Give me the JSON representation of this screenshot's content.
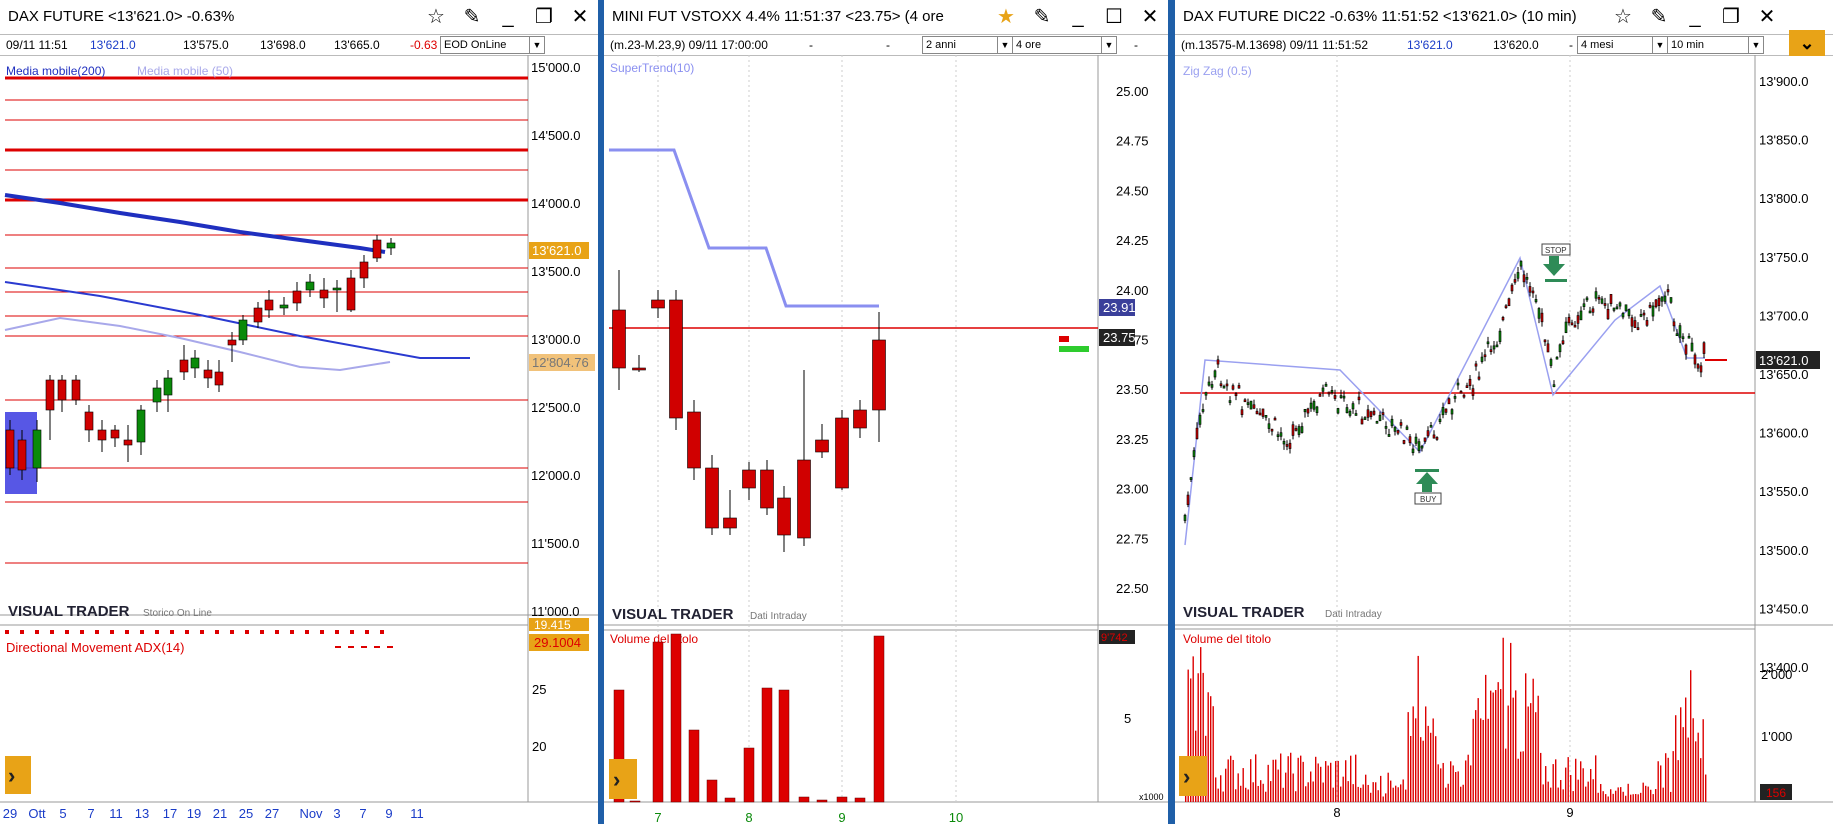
{
  "panels": {
    "left": {
      "title": "DAX FUTURE <13'621.0> -0.63%",
      "info": {
        "datetime": "09/11 11:51",
        "last": "13'621.0",
        "open": "13'575.0",
        "high": "13'698.0",
        "low": "13'665.0",
        "change": "-0.63"
      },
      "mode_dropdown": "EOD OnLine",
      "ma200_label": "Media mobile(200)",
      "ma50_label": "Media mobile (50)",
      "price_ticks": [
        "15'000.0",
        "14'500.0",
        "14'000.0",
        "13'500.0",
        "13'000.0",
        "12'500.0",
        "12'000.0",
        "11'500.0",
        "11'000.0"
      ],
      "price_badge": "13'621.0",
      "ma50_badge": "12'804.76",
      "logo": "VISUAL TRADER",
      "logo_sub": "Storico On Line",
      "adx_label": "Directional Movement ADX(14)",
      "adx_badge1": "19.415",
      "adx_badge2": "29.1004",
      "adx_ticks": [
        "25",
        "20"
      ],
      "date_ticks": [
        "29",
        "Ott",
        "5",
        "7",
        "11",
        "13",
        "17",
        "19",
        "21",
        "25",
        "27",
        "Nov",
        "3",
        "7",
        "9",
        "11"
      ]
    },
    "middle": {
      "title": "MINI FUT VSTOXX 4.4% 11:51:37  <23.75> (4 ore",
      "info": {
        "range": "(m.23-M.23,9) 09/11 17:00:00",
        "dash1": "-",
        "dash2": "-",
        "dash3": "-"
      },
      "period_dropdown": "2 anni",
      "interval_dropdown": "4 ore",
      "indicator_label": "SuperTrend(10)",
      "price_ticks": [
        "25.00",
        "24.75",
        "24.50",
        "24.25",
        "24.00",
        "23.75",
        "23.50",
        "23.25",
        "23.00",
        "22.75",
        "22.50"
      ],
      "badge_supertrend": "23.91",
      "badge_price": "23.75",
      "logo": "VISUAL TRADER",
      "logo_sub": "Dati Intraday",
      "volume_label": "Volume del titolo",
      "volume_badge": "9'742",
      "volume_ticks": [
        "5"
      ],
      "volume_unit": "x1000",
      "date_ticks": [
        "7",
        "8",
        "9",
        "10"
      ]
    },
    "right": {
      "title": "DAX FUTURE DIC22 -0.63% 11:51:52  <13'621.0> (10 min)",
      "info": {
        "range": "(m.13575-M.13698) 09/11 11:51:52",
        "last": "13'621.0",
        "prev": "13'620.0",
        "dash": "-"
      },
      "period_dropdown": "4 mesi",
      "interval_dropdown": "10 min",
      "indicator_label": "Zig Zag (0.5)",
      "price_ticks": [
        "13'900.0",
        "13'850.0",
        "13'800.0",
        "13'750.0",
        "13'700.0",
        "13'650.0",
        "13'600.0",
        "13'550.0",
        "13'500.0",
        "13'450.0",
        "13'400.0"
      ],
      "price_badge": "13'621.0",
      "stop_label": "STOP",
      "buy_label": "BUY",
      "logo": "VISUAL TRADER",
      "logo_sub": "Dati Intraday",
      "volume_label": "Volume del titolo",
      "volume_ticks": [
        "2'000",
        "1'000"
      ],
      "volume_badge": "156",
      "date_ticks": [
        "8",
        "9"
      ]
    }
  },
  "colors": {
    "up": "#0a8a0a",
    "down": "#d00000",
    "ma200": "#1f2fbf",
    "ma50": "#a8a8ea",
    "supertrend": "#8a8ff0",
    "accent": "#e8a317"
  },
  "icons": [
    "star-icon",
    "pen-icon",
    "minimize-icon",
    "maximize-icon",
    "close-icon",
    "collapse-chevron-icon",
    "play-arrow-icon"
  ]
}
